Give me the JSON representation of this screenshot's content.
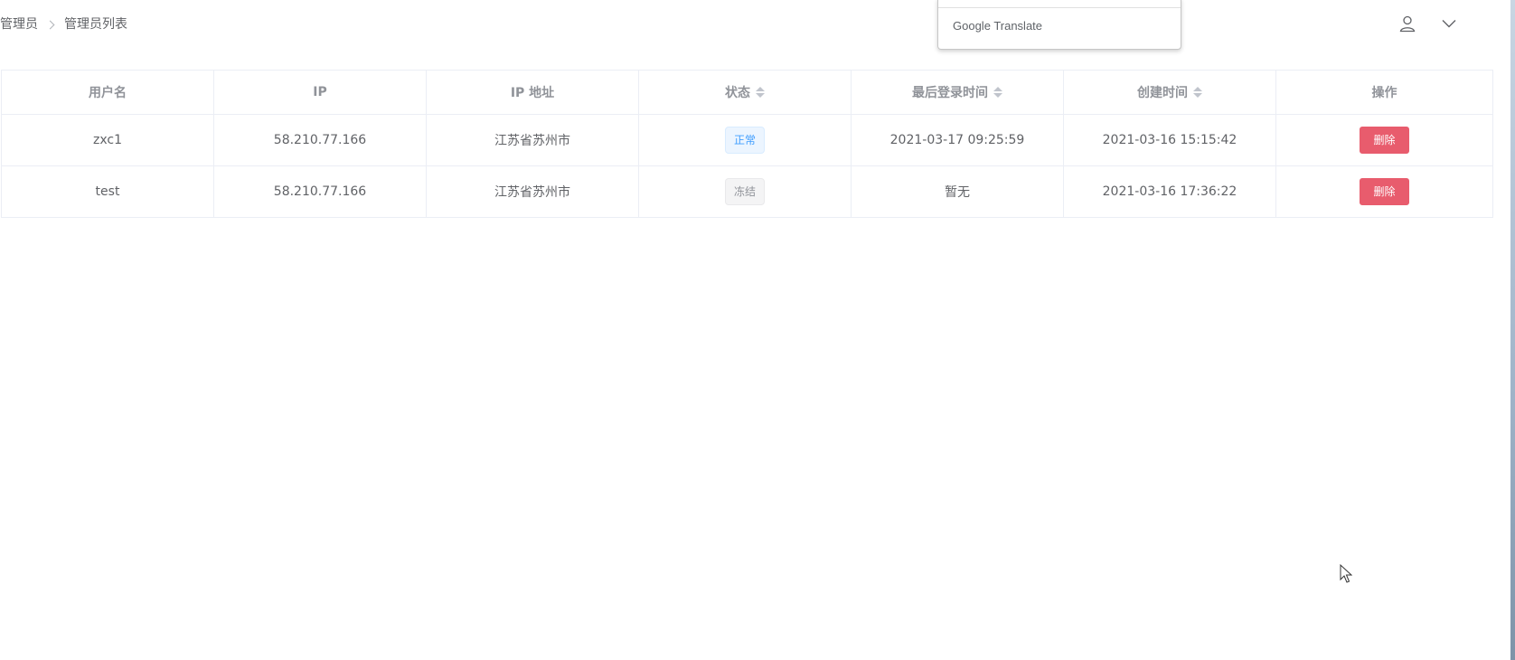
{
  "breadcrumb": {
    "root": "管理员",
    "current": "管理员列表"
  },
  "header": {
    "user_icon": "user-icon",
    "dropdown_icon": "chevron-down-icon"
  },
  "translate_popup": {
    "brand_google": "Google",
    "brand_translate": "Translate"
  },
  "table": {
    "columns": [
      {
        "label": "用户名",
        "sortable": false
      },
      {
        "label": "IP",
        "sortable": false
      },
      {
        "label": "IP 地址",
        "sortable": false
      },
      {
        "label": "状态",
        "sortable": true
      },
      {
        "label": "最后登录时间",
        "sortable": true
      },
      {
        "label": "创建时间",
        "sortable": true
      },
      {
        "label": "操作",
        "sortable": false
      }
    ],
    "rows": [
      {
        "username": "zxc1",
        "ip": "58.210.77.166",
        "location": "江苏省苏州市",
        "status": "正常",
        "last_login": "2021-03-17 09:25:59",
        "created": "2021-03-16 15:15:42",
        "action": "删除"
      },
      {
        "username": "test",
        "ip": "58.210.77.166",
        "location": "江苏省苏州市",
        "status": "冻结",
        "last_login": "暂无",
        "created": "2021-03-16 17:36:22",
        "action": "删除"
      }
    ]
  },
  "colors": {
    "danger": "#e85c6d",
    "primary": "#409eff",
    "border": "#ebeef5"
  }
}
